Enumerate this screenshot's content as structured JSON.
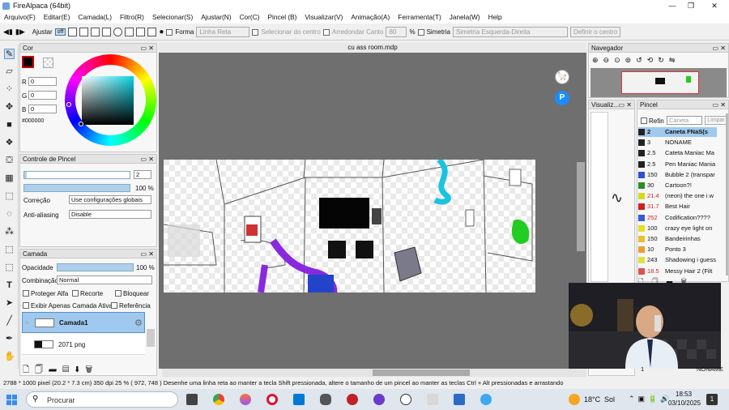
{
  "window": {
    "title": "FireAlpaca (64bit)",
    "minimize": "—",
    "maximize": "❐",
    "close": "✕"
  },
  "menu": [
    "Arquivo(F)",
    "Editar(E)",
    "Camada(L)",
    "Filtro(R)",
    "Selecionar(S)",
    "Ajustar(N)",
    "Cor(C)",
    "Pincel (B)",
    "Visualizar(V)",
    "Animação(A)",
    "Ferramenta(T)",
    "Janela(W)",
    "Help"
  ],
  "toolbar": {
    "adjust_label": "Ajustar",
    "off_label": "off",
    "shape_label": "Forma",
    "shape_value": "Linha Reta",
    "center_label": "Selecionar do centro",
    "round_label": "Arredondar Canto",
    "round_value": "80",
    "percent": "%",
    "symmetry_label": "Simetria",
    "symmetry_value": "Simetria Esquerda-Direita",
    "define_center": "Definir o centro"
  },
  "color_panel": {
    "title": "Cor",
    "r_label": "R",
    "r_value": "0",
    "g_label": "G",
    "g_value": "0",
    "b_label": "B",
    "b_value": "0",
    "hex": "#000000",
    "primary_color": "#000000"
  },
  "brush_control": {
    "title": "Controle de Pincel",
    "size_value": "2",
    "opacity_value": "100 %",
    "correction_label": "Correção",
    "correction_value": "Use configurações globais",
    "antialias_label": "Anti-aliasing",
    "antialias_value": "Disable"
  },
  "layer_panel": {
    "title": "Camada",
    "opacity_label": "Opacidade",
    "opacity_value": "100 %",
    "blend_label": "Combinação",
    "blend_value": "Normal",
    "protect_alpha": "Proteger Alfa",
    "clip": "Recorte",
    "lock": "Bloquear",
    "show_active": "Exibir Apenas Camada Ativa",
    "reference": "Referência",
    "layers": [
      {
        "name": "Camada1",
        "active": true
      },
      {
        "name": "2071 png",
        "active": false
      }
    ]
  },
  "document": {
    "tab": "cu ass room.mdp"
  },
  "navigator": {
    "title": "Navegador"
  },
  "view_panel": {
    "title": "Visualiz..."
  },
  "brush_panel": {
    "title": "Pincel",
    "refine_label": "Refin",
    "search_placeholder": "Caneta",
    "clear_label": "Limpar",
    "items": [
      {
        "size": "2",
        "name": "Caneta FNaS(s",
        "color": "#222222",
        "selected": true
      },
      {
        "size": "3",
        "name": "NONAME",
        "color": "#222222",
        "selected": false
      },
      {
        "size": "2.5",
        "name": "Cateta Maniac Ma",
        "color": "#222222",
        "selected": false
      },
      {
        "size": "2.5",
        "name": "Pen Maniac Mania",
        "color": "#222222",
        "selected": false
      },
      {
        "size": "150",
        "name": "Bubble 2 (transpar",
        "color": "#2e4fd8",
        "selected": false
      },
      {
        "size": "30",
        "name": "Cartoon?!",
        "color": "#2a8c2a",
        "selected": false
      },
      {
        "size": "21.4",
        "name": "(neon) the one i w",
        "color": "#d8d820",
        "selected": false,
        "red": true
      },
      {
        "size": "31.7",
        "name": "Best Hair",
        "color": "#d02020",
        "selected": false,
        "red": true
      },
      {
        "size": "252",
        "name": "Codification????",
        "color": "#3a5ad0",
        "selected": false,
        "red": true
      },
      {
        "size": "100",
        "name": "crazy eye light on",
        "color": "#e8e020",
        "selected": false
      },
      {
        "size": "150",
        "name": "Bandeirinhas",
        "color": "#e8c030",
        "selected": false
      },
      {
        "size": "10",
        "name": "Ponto 3",
        "color": "#e8a030",
        "selected": false
      },
      {
        "size": "243",
        "name": "Shadowing i guess",
        "color": "#e0e040",
        "selected": false
      },
      {
        "size": "18.5",
        "name": "Messy Hair 2 (Filt",
        "color": "#e05050",
        "selected": false,
        "red": true
      }
    ],
    "footer_label": "NONAME",
    "footer_value": "1"
  },
  "status": {
    "dimensions": "2788 * 1000 pixel",
    "size_cm": "(20.2 * 7.3 cm)",
    "dpi": "350 dpi",
    "zoom": "25 %",
    "cursor": "( 972, 748 )",
    "hint": "Desenhe uma linha reta ao manter a tecla Shift pressionada, altere o tamanho de um pincel ao manter as teclas Ctrl + Alt pressionadas e arrastando"
  },
  "taskbar": {
    "search_placeholder": "Procurar",
    "weather_temp": "18°C",
    "weather_text": "Sol",
    "time": "18:53",
    "date": "03/10/2025",
    "notifications": "1"
  }
}
